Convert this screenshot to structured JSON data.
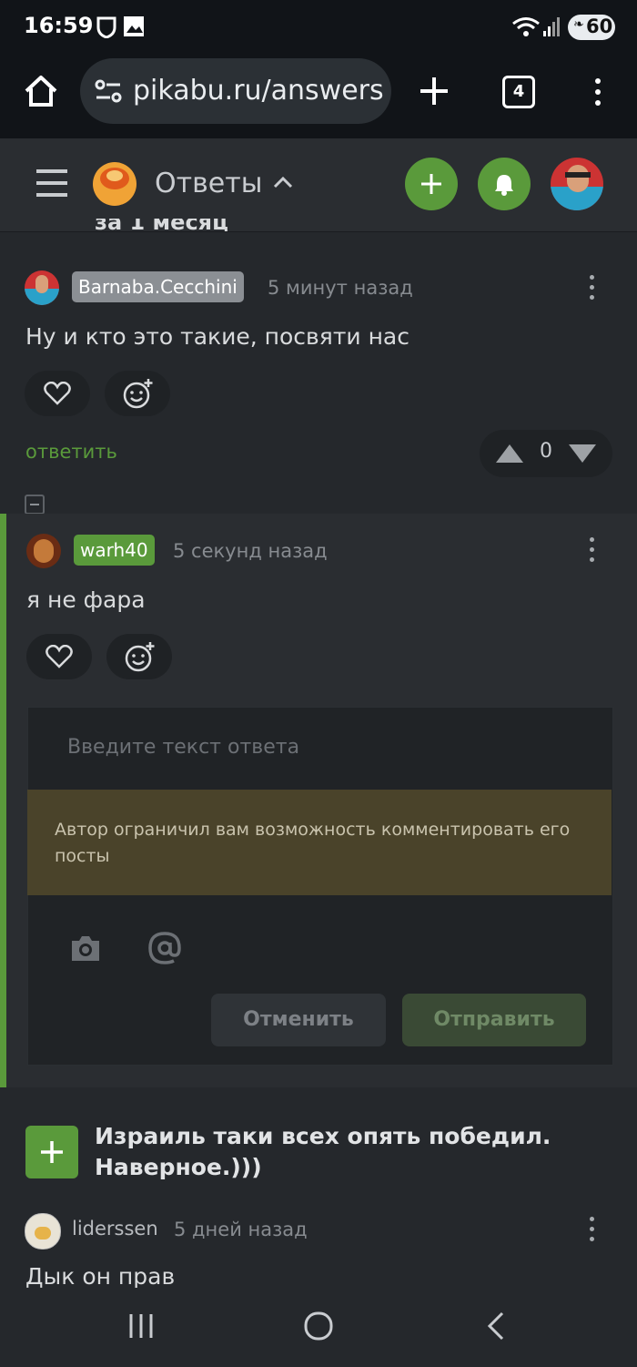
{
  "status_bar": {
    "time": "16:59",
    "battery": "60"
  },
  "browser": {
    "url": "pikabu.ru/answers",
    "tab_count": "4"
  },
  "header": {
    "title": "Ответы"
  },
  "cut_off_text": "за 1 месяц",
  "comments": [
    {
      "user": "Barnaba.Cecchini",
      "time": "5 минут назад",
      "text": "Ну и кто это такие, посвяти нас",
      "reply_label": "ответить",
      "rating": "0"
    },
    {
      "user": "warh40",
      "time": "5 секунд назад",
      "text": "я не фара"
    }
  ],
  "reply_form": {
    "placeholder": "Введите текст ответа",
    "notice": "Автор ограничил вам возможность комментировать его посты",
    "cancel_label": "Отменить",
    "send_label": "Отправить"
  },
  "post": {
    "title": "Израиль таки всех опять победил. Наверное.)))"
  },
  "post_comment": {
    "user": "liderssen",
    "time": "5 дней назад",
    "text": "Дык он прав"
  },
  "colors": {
    "accent": "#5a9a3b",
    "notice_bg": "#4a432a",
    "background": "#25282c"
  }
}
